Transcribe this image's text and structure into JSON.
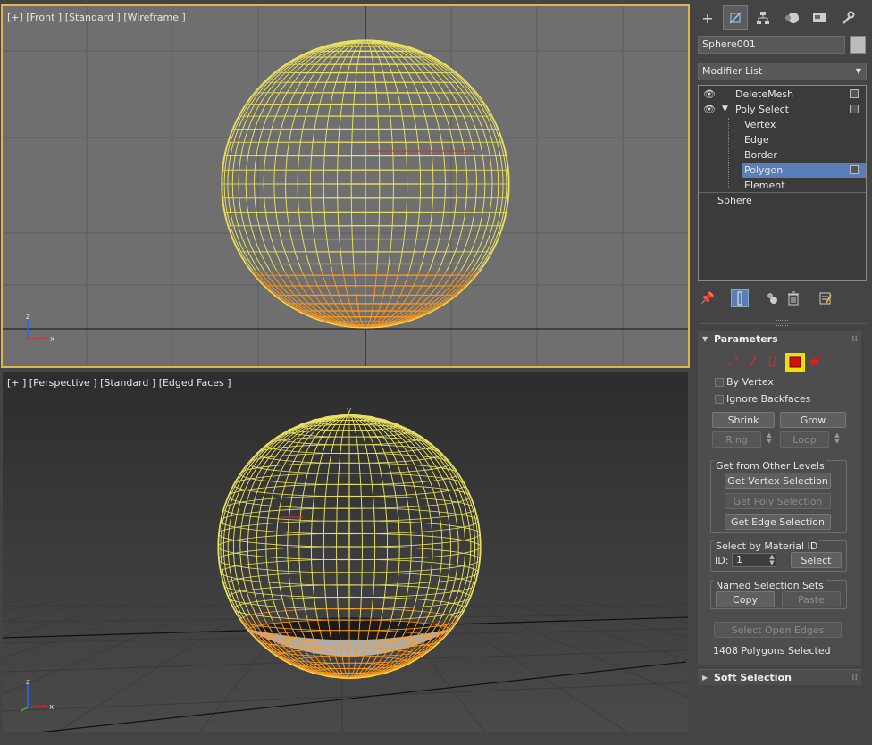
{
  "viewports": {
    "front_label": "[+] [Front ] [Standard ] [Wireframe ]",
    "persp_label": "[+ ] [Perspective ] [Standard ] [Edged Faces ]",
    "front_axis": {
      "z": "z",
      "x": "x"
    },
    "persp_axis": {
      "z": "z",
      "x": "x",
      "y": "y"
    },
    "colors": {
      "wire": "#e8e060",
      "selected": "#ff9a1a",
      "active_border": "#e0b64a"
    }
  },
  "panel": {
    "tabs": [
      {
        "icon": "plus-icon"
      },
      {
        "icon": "modify-icon"
      },
      {
        "icon": "hierarchy-icon"
      },
      {
        "icon": "motion-icon"
      },
      {
        "icon": "display-icon"
      },
      {
        "icon": "utilities-icon"
      }
    ],
    "object_name": "Sphere001",
    "modifier_list": "Modifier List",
    "stack": {
      "delete_mesh": "DeleteMesh",
      "poly_select": "Poly Select",
      "vertex": "Vertex",
      "edge": "Edge",
      "border": "Border",
      "polygon": "Polygon",
      "element": "Element",
      "sphere": "Sphere"
    },
    "parameters": {
      "title": "Parameters",
      "by_vertex": "By Vertex",
      "ignore_backfaces": "Ignore Backfaces",
      "shrink": "Shrink",
      "grow": "Grow",
      "ring": "Ring",
      "loop": "Loop",
      "get_from_other_levels": "Get from Other Levels",
      "get_vertex_selection": "Get Vertex Selection",
      "get_poly_selection": "Get Poly Selection",
      "get_edge_selection": "Get Edge Selection",
      "select_by_material_id": "Select by Material ID",
      "id_label": "ID:",
      "id_value": "1",
      "select": "Select",
      "named_selection_sets": "Named Selection Sets",
      "copy": "Copy",
      "paste": "Paste",
      "select_open_edges": "Select Open Edges",
      "status": "1408 Polygons Selected"
    },
    "soft_selection": "Soft Selection"
  }
}
